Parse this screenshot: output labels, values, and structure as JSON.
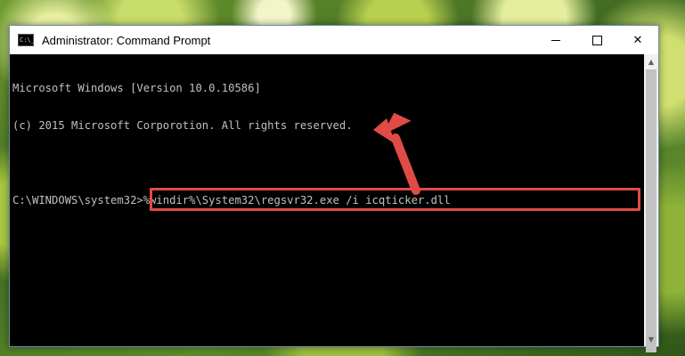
{
  "window": {
    "title": "Administrator: Command Prompt",
    "icon_text": "C:\\_",
    "controls": {
      "minimize": "minimize",
      "maximize": "maximize",
      "close": "✕"
    }
  },
  "console": {
    "lines": [
      "Microsoft Windows [Version 10.0.10586]",
      "(c) 2015 Microsoft Corporotion. All rights reserved."
    ],
    "prompt": "C:\\WINDOWS\\system32>",
    "command": "%windir%\\System32\\regsvr32.exe /i icqticker.dll"
  },
  "colors": {
    "highlight": "#e04b47",
    "arrow": "#e04b47",
    "console_bg": "#000000",
    "console_text": "#c0c0c0"
  },
  "icons": {
    "app": "command-prompt-icon",
    "pointer": "red-arrow-icon"
  }
}
